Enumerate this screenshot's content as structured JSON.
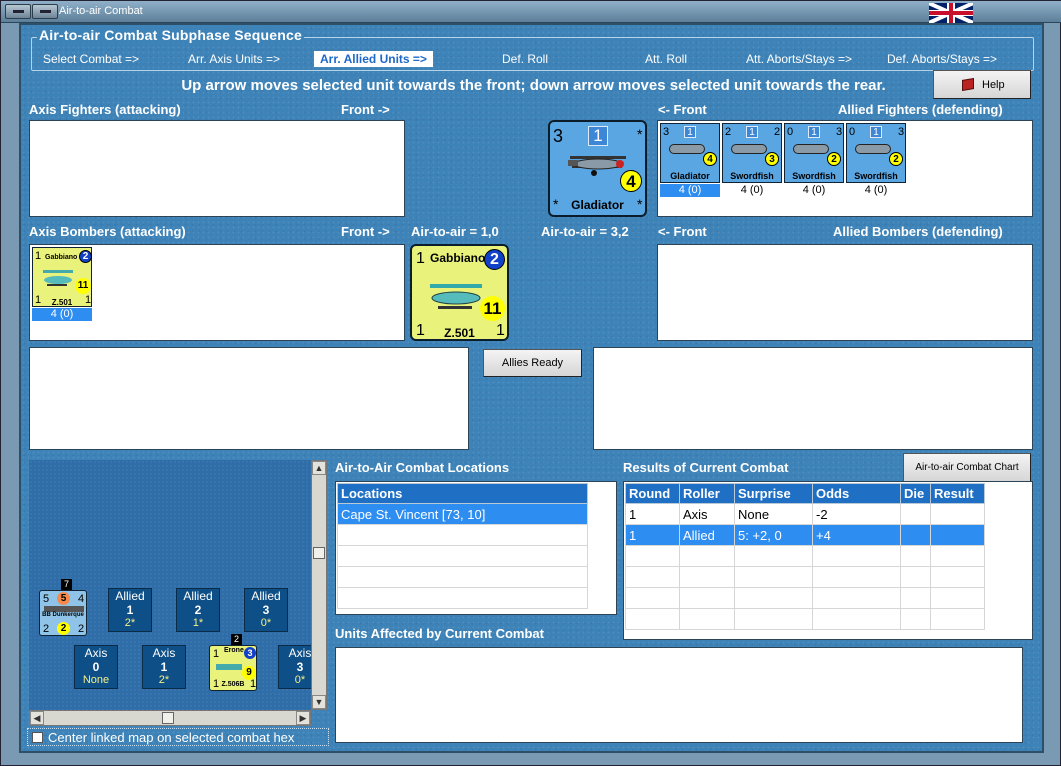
{
  "window": {
    "title": "Air-to-air Combat"
  },
  "sequence": {
    "legend": "Air-to-air Combat Subphase Sequence",
    "steps": [
      "Select Combat =>",
      "Arr. Axis Units =>",
      "Arr. Allied Units =>",
      "Def. Roll",
      "Att. Roll",
      "Att. Aborts/Stays =>",
      "Def. Aborts/Stays =>"
    ],
    "active_index": 2
  },
  "instruction": "Up arrow moves selected unit towards the front; down arrow moves selected unit towards the rear.",
  "help_button": "Help",
  "axis_fighters": {
    "label": "Axis Fighters (attacking)",
    "front": "Front ->"
  },
  "allied_fighters": {
    "label": "Allied Fighters (defending)",
    "front": "<- Front",
    "units": [
      {
        "name": "Gladiator",
        "tl": "3",
        "box": "1",
        "circle": "4",
        "status": "4 (0)",
        "selected": true
      },
      {
        "name": "Swordfish",
        "tl": "2",
        "box": "1",
        "tr": "2",
        "circle": "3",
        "status": "4 (0)",
        "selected": false
      },
      {
        "name": "Swordfish",
        "tl": "0",
        "box": "1",
        "tr": "3",
        "circle": "2",
        "status": "4 (0)",
        "selected": false
      },
      {
        "name": "Swordfish",
        "tl": "0",
        "box": "1",
        "tr": "3",
        "circle": "2",
        "status": "4 (0)",
        "selected": false
      }
    ]
  },
  "big_fighter": {
    "name": "Gladiator",
    "tl": "3",
    "box": "1",
    "circle": "4"
  },
  "axis_bombers": {
    "label": "Axis Bombers (attacking)",
    "front": "Front ->",
    "units": [
      {
        "name": "Gabbiano",
        "tl": "1",
        "circle": "2",
        "circle2": "11",
        "bl": "1",
        "br": "1",
        "code": "Z.501",
        "status": "4 (0)"
      }
    ]
  },
  "allied_bombers": {
    "label": "Allied Bombers (defending)",
    "front": "<- Front"
  },
  "air_to_air_axis": "Air-to-air = 1,0",
  "air_to_air_allied": "Air-to-air = 3,2",
  "big_bomber": {
    "name": "Gabbiano",
    "tl": "1",
    "circle": "2",
    "circle2": "11",
    "bl": "1",
    "br": "1",
    "code": "Z.501"
  },
  "allies_ready": "Allies Ready",
  "map": {
    "ship": {
      "top": "7",
      "tl": "5",
      "circle": "5",
      "tr": "4",
      "name": "BB Dunkerque",
      "bl": "2",
      "circle2": "2",
      "br": "2"
    },
    "allied_tiles": [
      {
        "side": "Allied",
        "n": "1",
        "v": "2*"
      },
      {
        "side": "Allied",
        "n": "2",
        "v": "1*"
      },
      {
        "side": "Allied",
        "n": "3",
        "v": "0*"
      }
    ],
    "axis_tiles": [
      {
        "side": "Axis",
        "n": "0",
        "v": "None"
      },
      {
        "side": "Axis",
        "n": "1",
        "v": "2*"
      },
      {
        "side": "Axis",
        "n": "3",
        "v": "0*"
      }
    ],
    "erone": {
      "top": "2",
      "tl": "1",
      "name": "Erone",
      "circle": "3",
      "circle2": "9",
      "bl": "1",
      "code": "Z.506B",
      "br": "1"
    }
  },
  "center_checkbox": "Center linked map on selected combat hex",
  "locations": {
    "label": "Air-to-Air Combat Locations",
    "header": "Locations",
    "rows": [
      "Cape St. Vincent [73, 10]"
    ]
  },
  "results": {
    "label": "Results of Current Combat",
    "chart_button": "Air-to-air Combat Chart",
    "columns": [
      "Round",
      "Roller",
      "Surprise",
      "Odds",
      "Die",
      "Result"
    ],
    "rows": [
      [
        "1",
        "Axis",
        "None",
        "-2",
        "",
        ""
      ],
      [
        "1",
        "Allied",
        "5: +2, 0",
        "+4",
        "",
        ""
      ]
    ],
    "selected_row": 1
  },
  "units_affected": {
    "label": "Units Affected by Current Combat"
  },
  "colors": {
    "panel": "#3e83b8",
    "selected": "#2e8df0",
    "counter_blue": "#5aa6e3",
    "counter_yellow": "#e9f27b"
  }
}
